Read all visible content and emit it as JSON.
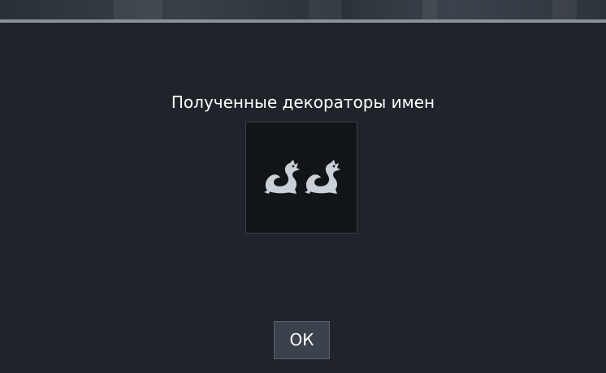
{
  "dialog": {
    "title": "Полученные декораторы имен",
    "decorator_icon": "twin-dragons-icon",
    "ok_label": "ОК"
  },
  "colors": {
    "background": "#1f232a",
    "tile": "#111518",
    "icon": "#c9d0d6",
    "button": "#3b424b",
    "text": "#ffffff"
  }
}
